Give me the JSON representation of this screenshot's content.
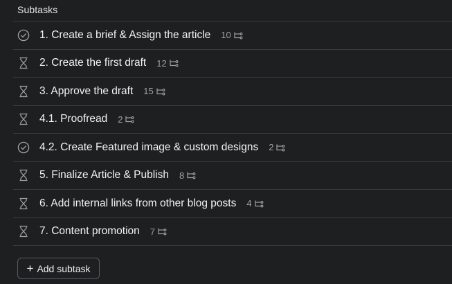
{
  "section": {
    "title": "Subtasks"
  },
  "subtasks": [
    {
      "name": "1. Create a brief & Assign the article",
      "count": "10",
      "status_icon": "check-circle-icon"
    },
    {
      "name": "2. Create the first draft",
      "count": "12",
      "status_icon": "hourglass-icon"
    },
    {
      "name": "3. Approve the draft",
      "count": "15",
      "status_icon": "hourglass-icon"
    },
    {
      "name": "4.1. Proofread",
      "count": "2",
      "status_icon": "hourglass-icon"
    },
    {
      "name": "4.2. Create Featured image & custom designs",
      "count": "2",
      "status_icon": "check-circle-icon"
    },
    {
      "name": "5. Finalize Article & Publish",
      "count": "8",
      "status_icon": "hourglass-icon"
    },
    {
      "name": "6. Add internal links from other blog posts",
      "count": "4",
      "status_icon": "hourglass-icon"
    },
    {
      "name": "7. Content promotion",
      "count": "7",
      "status_icon": "hourglass-icon"
    }
  ],
  "add_button": {
    "label": "Add subtask",
    "icon": "plus-icon"
  },
  "colors": {
    "background": "#1e1f21",
    "divider": "#3a3b3e",
    "text": "#f3f3f4",
    "muted": "#a2a0a2"
  }
}
